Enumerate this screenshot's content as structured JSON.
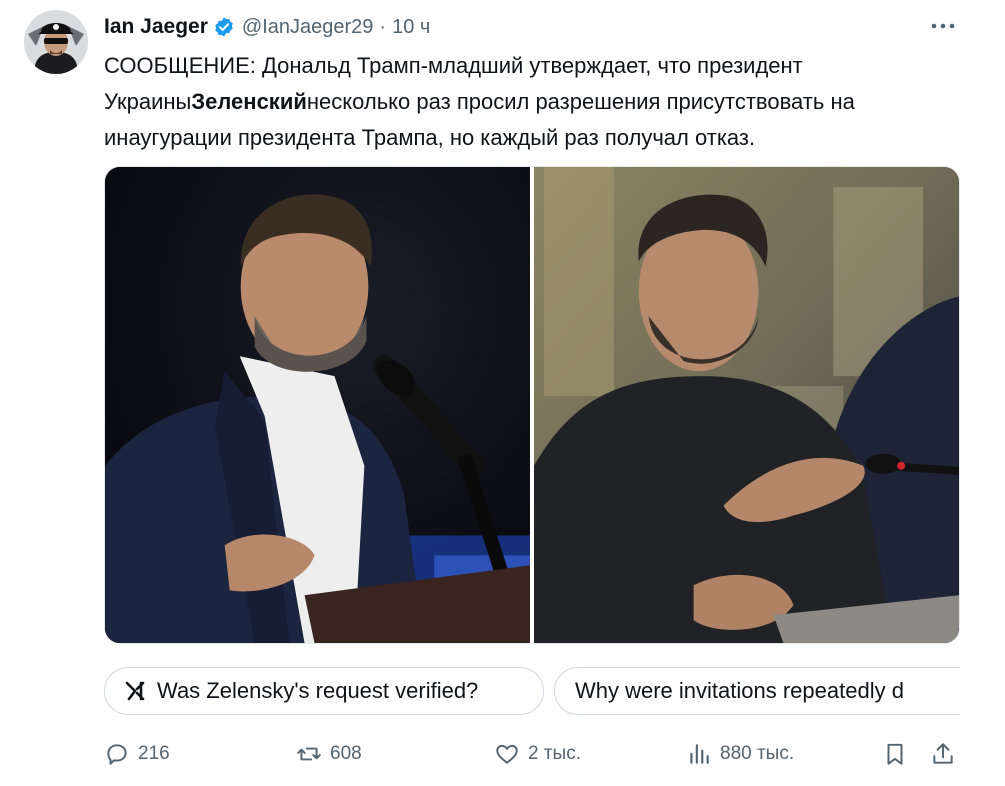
{
  "tweet": {
    "author_name": "Ian Jaeger",
    "handle": "@IanJaeger29",
    "separator": "·",
    "time": "10 ч",
    "text_line1": "СООБЩЕНИЕ: Дональд Трамп-младший утверждает, что президент",
    "text_line2_pre": "Украины",
    "text_line2_bold": "Зеленский",
    "text_line2_post": "несколько раз просил разрешения присутствовать на",
    "text_line3": "инаугурации президента Трампа, но каждый раз получал отказ."
  },
  "icons": {
    "verified": "verified-badge-icon",
    "more": "more-horizontal-icon",
    "grok": "grok-icon",
    "reply": "reply-icon",
    "retweet": "retweet-icon",
    "like": "heart-icon",
    "views": "views-icon",
    "bookmark": "bookmark-icon",
    "share": "share-icon"
  },
  "colors": {
    "verified": "#1d9bf0",
    "text": "#0f1419",
    "secondary": "#536471",
    "border": "#cfd9de"
  },
  "suggestions": [
    {
      "label": "Was Zelensky's request verified?"
    },
    {
      "label": "Why were invitations repeatedly d"
    }
  ],
  "metrics": {
    "replies": "216",
    "retweets": "608",
    "likes": "2 тыс.",
    "views": "880 тыс."
  }
}
